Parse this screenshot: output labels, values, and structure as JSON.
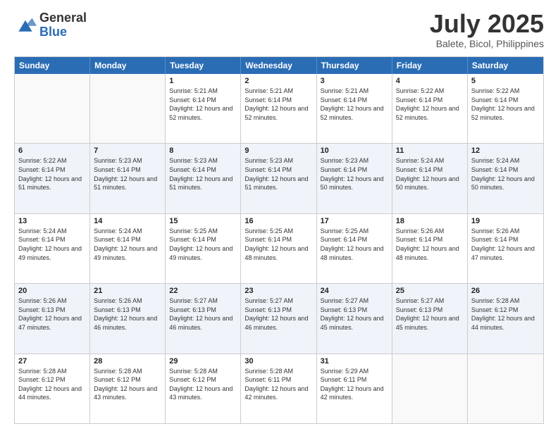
{
  "logo": {
    "general": "General",
    "blue": "Blue"
  },
  "title": "July 2025",
  "location": "Balete, Bicol, Philippines",
  "days": [
    "Sunday",
    "Monday",
    "Tuesday",
    "Wednesday",
    "Thursday",
    "Friday",
    "Saturday"
  ],
  "weeks": [
    [
      {
        "day": "",
        "info": ""
      },
      {
        "day": "",
        "info": ""
      },
      {
        "day": "1",
        "info": "Sunrise: 5:21 AM\nSunset: 6:14 PM\nDaylight: 12 hours and 52 minutes."
      },
      {
        "day": "2",
        "info": "Sunrise: 5:21 AM\nSunset: 6:14 PM\nDaylight: 12 hours and 52 minutes."
      },
      {
        "day": "3",
        "info": "Sunrise: 5:21 AM\nSunset: 6:14 PM\nDaylight: 12 hours and 52 minutes."
      },
      {
        "day": "4",
        "info": "Sunrise: 5:22 AM\nSunset: 6:14 PM\nDaylight: 12 hours and 52 minutes."
      },
      {
        "day": "5",
        "info": "Sunrise: 5:22 AM\nSunset: 6:14 PM\nDaylight: 12 hours and 52 minutes."
      }
    ],
    [
      {
        "day": "6",
        "info": "Sunrise: 5:22 AM\nSunset: 6:14 PM\nDaylight: 12 hours and 51 minutes."
      },
      {
        "day": "7",
        "info": "Sunrise: 5:23 AM\nSunset: 6:14 PM\nDaylight: 12 hours and 51 minutes."
      },
      {
        "day": "8",
        "info": "Sunrise: 5:23 AM\nSunset: 6:14 PM\nDaylight: 12 hours and 51 minutes."
      },
      {
        "day": "9",
        "info": "Sunrise: 5:23 AM\nSunset: 6:14 PM\nDaylight: 12 hours and 51 minutes."
      },
      {
        "day": "10",
        "info": "Sunrise: 5:23 AM\nSunset: 6:14 PM\nDaylight: 12 hours and 50 minutes."
      },
      {
        "day": "11",
        "info": "Sunrise: 5:24 AM\nSunset: 6:14 PM\nDaylight: 12 hours and 50 minutes."
      },
      {
        "day": "12",
        "info": "Sunrise: 5:24 AM\nSunset: 6:14 PM\nDaylight: 12 hours and 50 minutes."
      }
    ],
    [
      {
        "day": "13",
        "info": "Sunrise: 5:24 AM\nSunset: 6:14 PM\nDaylight: 12 hours and 49 minutes."
      },
      {
        "day": "14",
        "info": "Sunrise: 5:24 AM\nSunset: 6:14 PM\nDaylight: 12 hours and 49 minutes."
      },
      {
        "day": "15",
        "info": "Sunrise: 5:25 AM\nSunset: 6:14 PM\nDaylight: 12 hours and 49 minutes."
      },
      {
        "day": "16",
        "info": "Sunrise: 5:25 AM\nSunset: 6:14 PM\nDaylight: 12 hours and 48 minutes."
      },
      {
        "day": "17",
        "info": "Sunrise: 5:25 AM\nSunset: 6:14 PM\nDaylight: 12 hours and 48 minutes."
      },
      {
        "day": "18",
        "info": "Sunrise: 5:26 AM\nSunset: 6:14 PM\nDaylight: 12 hours and 48 minutes."
      },
      {
        "day": "19",
        "info": "Sunrise: 5:26 AM\nSunset: 6:14 PM\nDaylight: 12 hours and 47 minutes."
      }
    ],
    [
      {
        "day": "20",
        "info": "Sunrise: 5:26 AM\nSunset: 6:13 PM\nDaylight: 12 hours and 47 minutes."
      },
      {
        "day": "21",
        "info": "Sunrise: 5:26 AM\nSunset: 6:13 PM\nDaylight: 12 hours and 46 minutes."
      },
      {
        "day": "22",
        "info": "Sunrise: 5:27 AM\nSunset: 6:13 PM\nDaylight: 12 hours and 46 minutes."
      },
      {
        "day": "23",
        "info": "Sunrise: 5:27 AM\nSunset: 6:13 PM\nDaylight: 12 hours and 46 minutes."
      },
      {
        "day": "24",
        "info": "Sunrise: 5:27 AM\nSunset: 6:13 PM\nDaylight: 12 hours and 45 minutes."
      },
      {
        "day": "25",
        "info": "Sunrise: 5:27 AM\nSunset: 6:13 PM\nDaylight: 12 hours and 45 minutes."
      },
      {
        "day": "26",
        "info": "Sunrise: 5:28 AM\nSunset: 6:12 PM\nDaylight: 12 hours and 44 minutes."
      }
    ],
    [
      {
        "day": "27",
        "info": "Sunrise: 5:28 AM\nSunset: 6:12 PM\nDaylight: 12 hours and 44 minutes."
      },
      {
        "day": "28",
        "info": "Sunrise: 5:28 AM\nSunset: 6:12 PM\nDaylight: 12 hours and 43 minutes."
      },
      {
        "day": "29",
        "info": "Sunrise: 5:28 AM\nSunset: 6:12 PM\nDaylight: 12 hours and 43 minutes."
      },
      {
        "day": "30",
        "info": "Sunrise: 5:28 AM\nSunset: 6:11 PM\nDaylight: 12 hours and 42 minutes."
      },
      {
        "day": "31",
        "info": "Sunrise: 5:29 AM\nSunset: 6:11 PM\nDaylight: 12 hours and 42 minutes."
      },
      {
        "day": "",
        "info": ""
      },
      {
        "day": "",
        "info": ""
      }
    ]
  ]
}
